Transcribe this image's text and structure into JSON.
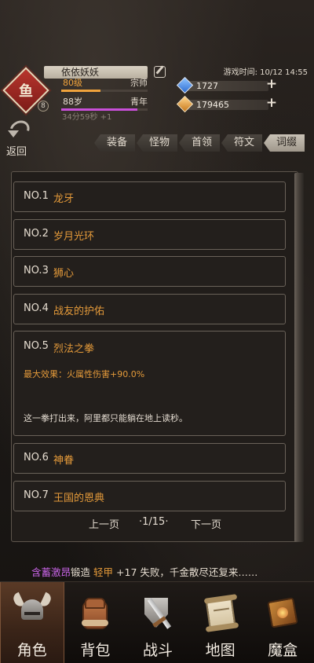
{
  "header": {
    "player_name": "依依妖妖",
    "avatar_glyph": "鱼",
    "avatar_badge": "8",
    "level": "80级",
    "rank": "宗师",
    "level_progress": 0.45,
    "age": "88岁",
    "age_stage": "青年",
    "age_progress": 0.88,
    "timer": "34分59秒 +1",
    "game_time": "游戏时间: 10/12 14:55",
    "resources": [
      {
        "name": "blue-gem",
        "value": "1727",
        "color": "#3f86e8"
      },
      {
        "name": "gold-gem",
        "value": "179465",
        "color": "#e59a34"
      }
    ]
  },
  "back": {
    "label": "返回"
  },
  "tabs": [
    {
      "label": "装备",
      "active": false
    },
    {
      "label": "怪物",
      "active": false
    },
    {
      "label": "首领",
      "active": false
    },
    {
      "label": "符文",
      "active": false
    },
    {
      "label": "词缀",
      "active": true
    }
  ],
  "entries": [
    {
      "no": "NO.1",
      "title": "龙牙"
    },
    {
      "no": "NO.2",
      "title": "岁月光环"
    },
    {
      "no": "NO.3",
      "title": "狮心"
    },
    {
      "no": "NO.4",
      "title": "战友的护佑"
    },
    {
      "no": "NO.5",
      "title": "烈法之拳",
      "effect": "最大效果：火属性伤害+90.0%",
      "desc": "这一拳打出来，阿里都只能躺在地上读秒。"
    },
    {
      "no": "NO.6",
      "title": "神眷"
    },
    {
      "no": "NO.7",
      "title": "王国的恩典"
    }
  ],
  "pager": {
    "prev": "上一页",
    "page": "·1/15·",
    "next": "下一页"
  },
  "ticker": {
    "player": "含蓄激昂",
    "verb": "锻造",
    "item": "轻甲",
    "rest": "+17 失败，千金散尽还复来……"
  },
  "nav": [
    {
      "label": "角色",
      "icon": "helmet-icon",
      "active": true
    },
    {
      "label": "背包",
      "icon": "backpack-icon",
      "active": false
    },
    {
      "label": "战斗",
      "icon": "sword-shield-icon",
      "active": false
    },
    {
      "label": "地图",
      "icon": "map-scroll-icon",
      "active": false
    },
    {
      "label": "魔盒",
      "icon": "magic-box-icon",
      "active": false
    }
  ],
  "colors": {
    "accent": "#e49a3a",
    "player_name": "#c864e6",
    "level_bar": "#f0a33c",
    "age_bar": "#c84fd8"
  }
}
